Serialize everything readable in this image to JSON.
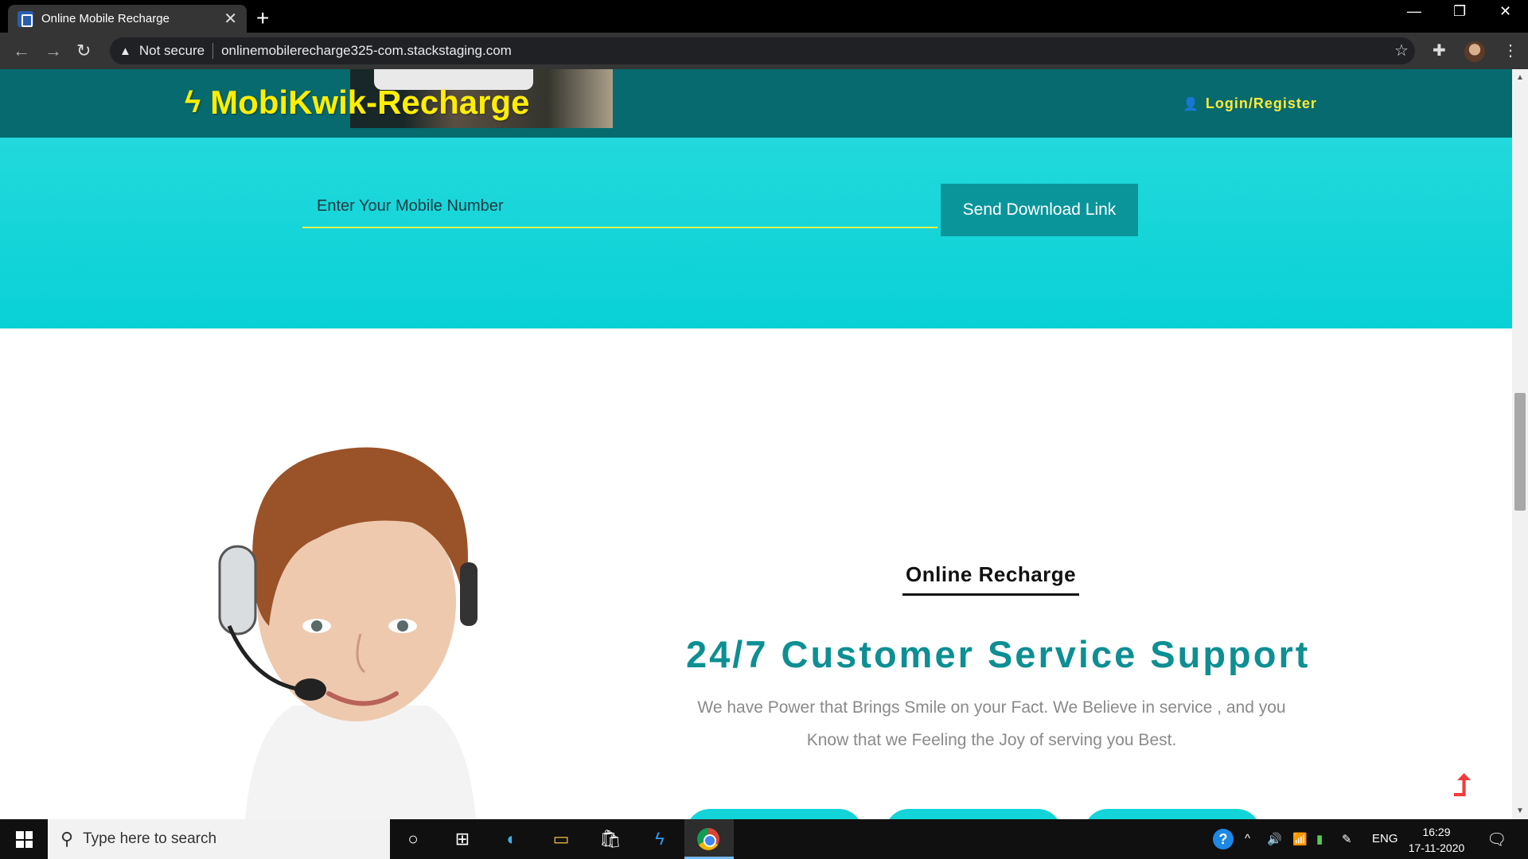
{
  "browser": {
    "tab_title": "Online Mobile Recharge",
    "security_label": "Not secure",
    "url": "onlinemobilerecharge325-com.stackstaging.com"
  },
  "site": {
    "brand": "MobiKwik-Recharge",
    "login_label": "Login/Register",
    "colors": {
      "header": "#066a6e",
      "hero": "#0fd3d8",
      "brand_yellow": "#ffee00",
      "accent_teal": "#0d8f93"
    }
  },
  "hero": {
    "mobile_placeholder": "Enter Your Mobile Number",
    "send_button": "Send Download Link"
  },
  "support": {
    "eyebrow": "Online Recharge",
    "headline": "24/7 Customer Service Support",
    "description": "We have Power that Brings Smile on your Fact. We Believe in service , and you Know that we Feeling the Joy of serving you Best."
  },
  "taskbar": {
    "search_placeholder": "Type here to search",
    "language": "ENG",
    "time": "16:29",
    "date": "17-11-2020"
  }
}
